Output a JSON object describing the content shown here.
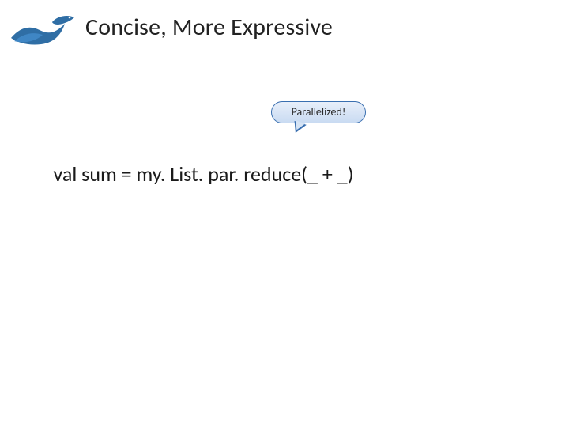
{
  "title": "Concise, More Expressive",
  "callout": "Parallelized!",
  "code": {
    "prefix": "val sum = my. List. ",
    "emph": "par",
    "suffix": ". reduce(_ + _)"
  },
  "colors": {
    "accent": "#2f6ea5",
    "calloutBorder": "#3a6fb0"
  }
}
